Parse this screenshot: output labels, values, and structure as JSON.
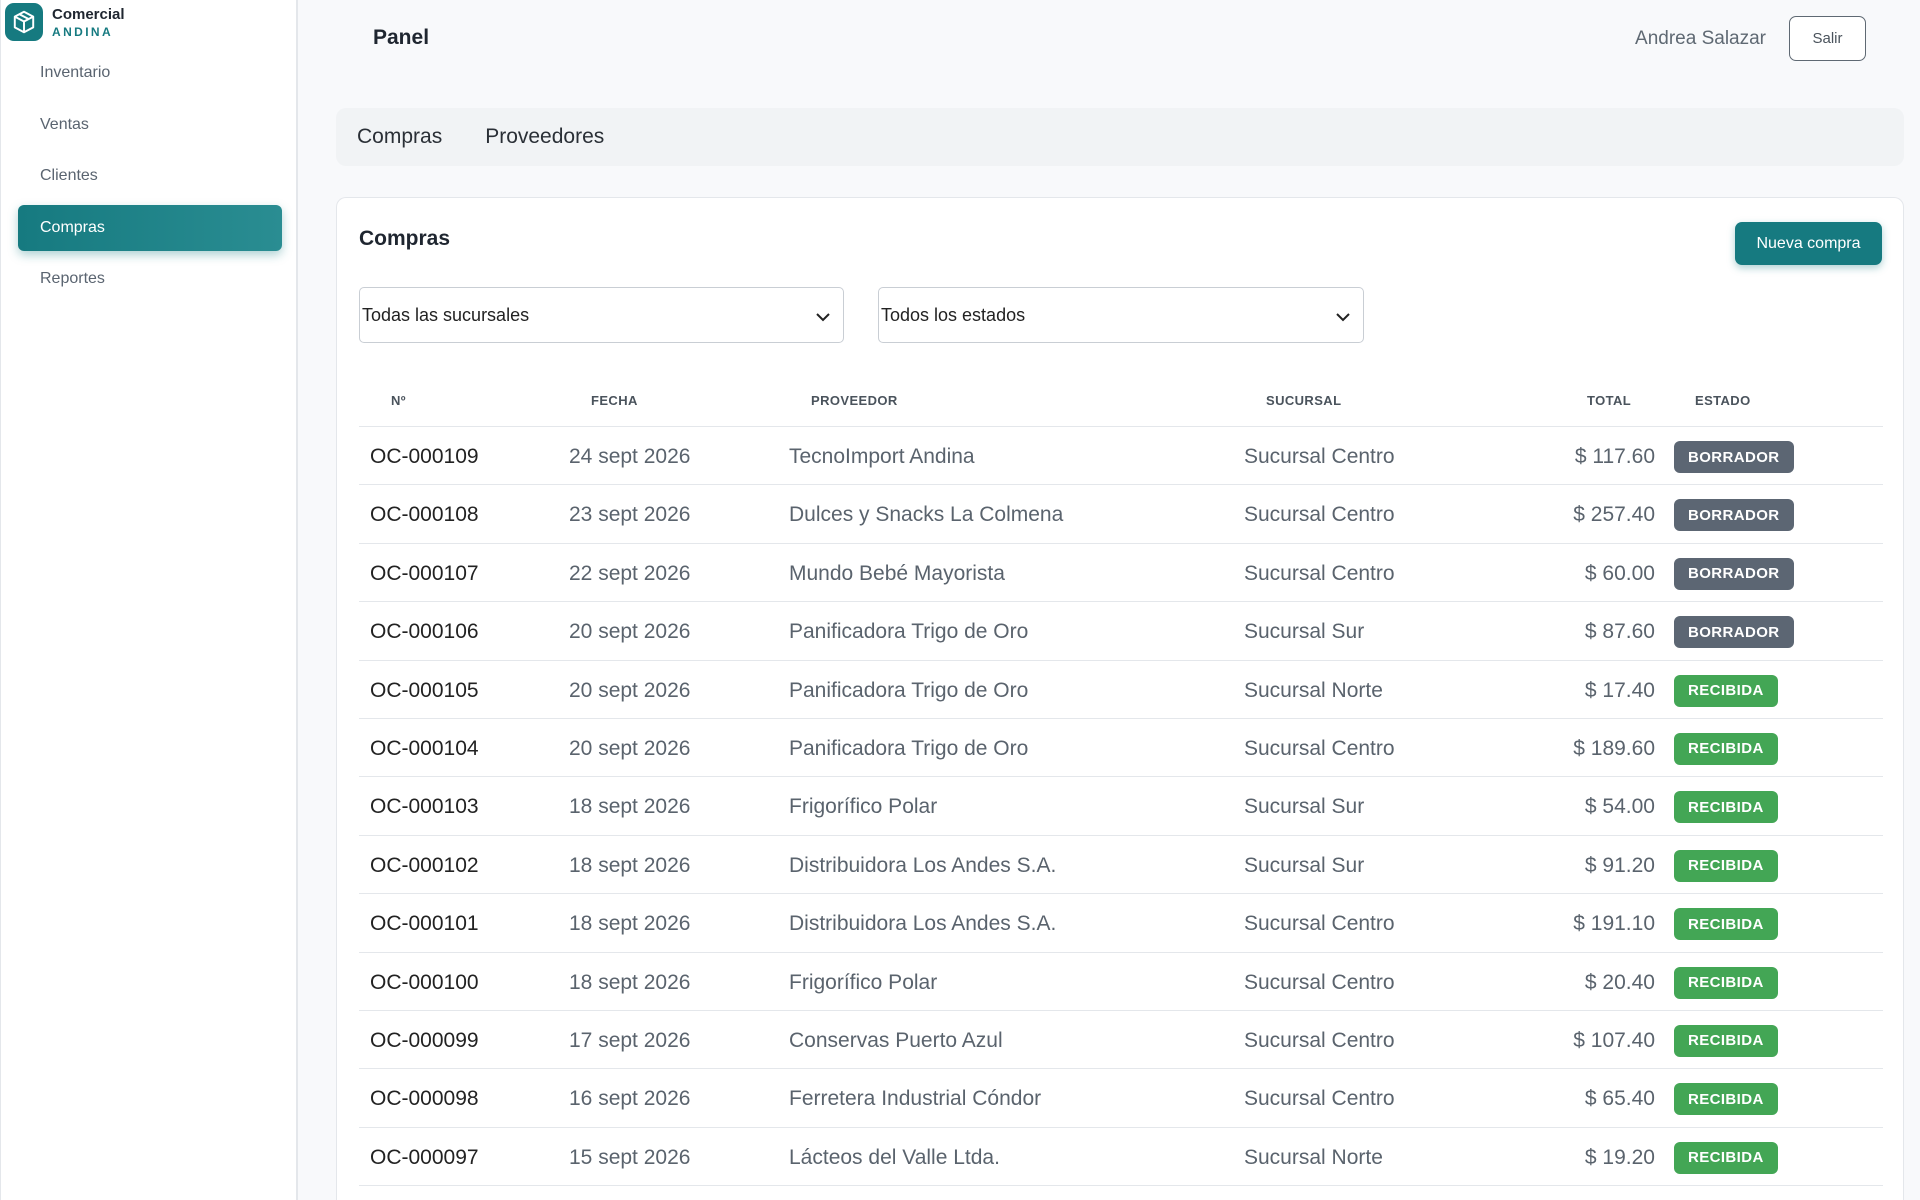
{
  "brand": {
    "name": "Comercial",
    "sub": "ANDINA",
    "logo_icon": "box-icon",
    "color": "#167a80"
  },
  "sidebar": {
    "items": [
      {
        "label": "Inventario",
        "active": false
      },
      {
        "label": "Ventas",
        "active": false
      },
      {
        "label": "Clientes",
        "active": false
      },
      {
        "label": "Compras",
        "active": true
      },
      {
        "label": "Reportes",
        "active": false
      }
    ]
  },
  "header": {
    "title": "Panel",
    "user_name": "Andrea Salazar",
    "logout_label": "Salir"
  },
  "tabs": [
    {
      "label": "Compras"
    },
    {
      "label": "Proveedores"
    }
  ],
  "card": {
    "title": "Compras",
    "new_button_label": "Nueva compra",
    "filter_branch": "Todas las sucursales",
    "filter_status": "Todos los estados"
  },
  "table": {
    "columns": [
      "Nº",
      "FECHA",
      "PROVEEDOR",
      "SUCURSAL",
      "TOTAL",
      "ESTADO"
    ],
    "rows": [
      {
        "num": "OC-000109",
        "date": "24 sept 2026",
        "provider": "TecnoImport Andina",
        "branch": "Sucursal Centro",
        "total": "$ 117.60",
        "status": "BORRADOR"
      },
      {
        "num": "OC-000108",
        "date": "23 sept 2026",
        "provider": "Dulces y Snacks La Colmena",
        "branch": "Sucursal Centro",
        "total": "$ 257.40",
        "status": "BORRADOR"
      },
      {
        "num": "OC-000107",
        "date": "22 sept 2026",
        "provider": "Mundo Bebé Mayorista",
        "branch": "Sucursal Centro",
        "total": "$ 60.00",
        "status": "BORRADOR"
      },
      {
        "num": "OC-000106",
        "date": "20 sept 2026",
        "provider": "Panificadora Trigo de Oro",
        "branch": "Sucursal Sur",
        "total": "$ 87.60",
        "status": "BORRADOR"
      },
      {
        "num": "OC-000105",
        "date": "20 sept 2026",
        "provider": "Panificadora Trigo de Oro",
        "branch": "Sucursal Norte",
        "total": "$ 17.40",
        "status": "RECIBIDA"
      },
      {
        "num": "OC-000104",
        "date": "20 sept 2026",
        "provider": "Panificadora Trigo de Oro",
        "branch": "Sucursal Centro",
        "total": "$ 189.60",
        "status": "RECIBIDA"
      },
      {
        "num": "OC-000103",
        "date": "18 sept 2026",
        "provider": "Frigorífico Polar",
        "branch": "Sucursal Sur",
        "total": "$ 54.00",
        "status": "RECIBIDA"
      },
      {
        "num": "OC-000102",
        "date": "18 sept 2026",
        "provider": "Distribuidora Los Andes S.A.",
        "branch": "Sucursal Sur",
        "total": "$ 91.20",
        "status": "RECIBIDA"
      },
      {
        "num": "OC-000101",
        "date": "18 sept 2026",
        "provider": "Distribuidora Los Andes S.A.",
        "branch": "Sucursal Centro",
        "total": "$ 191.10",
        "status": "RECIBIDA"
      },
      {
        "num": "OC-000100",
        "date": "18 sept 2026",
        "provider": "Frigorífico Polar",
        "branch": "Sucursal Centro",
        "total": "$ 20.40",
        "status": "RECIBIDA"
      },
      {
        "num": "OC-000099",
        "date": "17 sept 2026",
        "provider": "Conservas Puerto Azul",
        "branch": "Sucursal Centro",
        "total": "$ 107.40",
        "status": "RECIBIDA"
      },
      {
        "num": "OC-000098",
        "date": "16 sept 2026",
        "provider": "Ferretera Industrial Cóndor",
        "branch": "Sucursal Centro",
        "total": "$ 65.40",
        "status": "RECIBIDA"
      },
      {
        "num": "OC-000097",
        "date": "15 sept 2026",
        "provider": "Lácteos del Valle Ltda.",
        "branch": "Sucursal Norte",
        "total": "$ 19.20",
        "status": "RECIBIDA"
      }
    ]
  },
  "status_colors": {
    "BORRADOR": "#5c6673",
    "RECIBIDA": "#43a655"
  }
}
